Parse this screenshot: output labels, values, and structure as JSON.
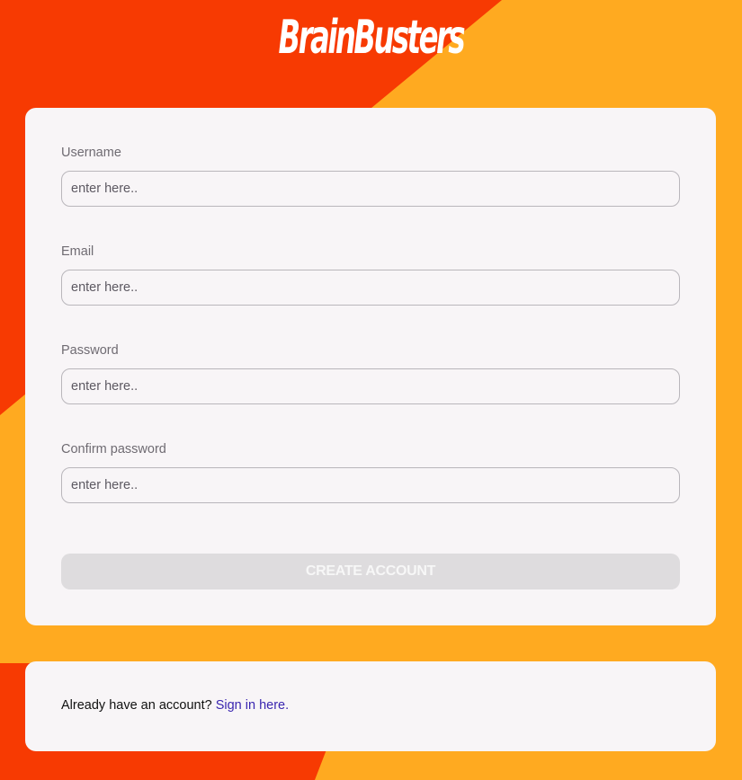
{
  "app": {
    "logo_text": "BrainBusters"
  },
  "colors": {
    "background_red": "#f73a02",
    "background_orange": "#ffaa20",
    "card_background": "#f8f5f7",
    "button_disabled": "#dedcde",
    "link": "#3a26b0"
  },
  "form": {
    "fields": [
      {
        "label": "Username",
        "placeholder": "enter here..",
        "value": ""
      },
      {
        "label": "Email",
        "placeholder": "enter here..",
        "value": ""
      },
      {
        "label": "Password",
        "placeholder": "enter here..",
        "value": ""
      },
      {
        "label": "Confirm password",
        "placeholder": "enter here..",
        "value": ""
      }
    ],
    "submit_label": "CREATE ACCOUNT",
    "submit_state": "disabled"
  },
  "signin": {
    "prompt": "Already have an account?",
    "link_label": "Sign in here."
  }
}
